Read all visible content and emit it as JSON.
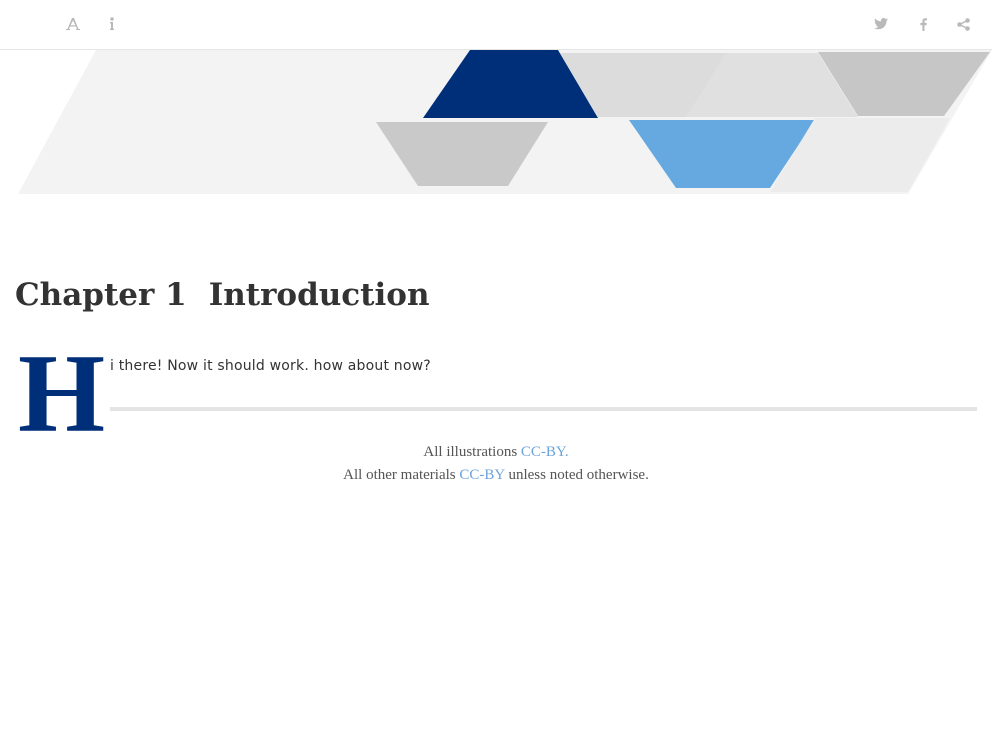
{
  "toolbar": {
    "icons": [
      "font-size-icon",
      "info-icon",
      "twitter-icon",
      "facebook-icon",
      "share-icon"
    ],
    "icon_color": "#b9b9b9"
  },
  "banner": {
    "colors": {
      "dark_blue": "#002f7a",
      "light_blue": "#66a9e1",
      "gray": "#c6c6c6",
      "light_gray": "#d8d8d8",
      "background_gray": "#f3f3f3"
    }
  },
  "chapter": {
    "number": "Chapter 1",
    "title": "Introduction"
  },
  "content": {
    "drop_cap": "H",
    "lead_text": "i there! Now it should work. how about now?",
    "drop_cap_color": "#002f7a"
  },
  "footer": {
    "line1_prefix": "All illustrations",
    "line1_link": "CC-BY.",
    "line2_prefix": "All other materials",
    "line2_link": "CC-BY",
    "line2_suffix": "unless noted otherwise.",
    "link_color": "#6ba3dc"
  }
}
